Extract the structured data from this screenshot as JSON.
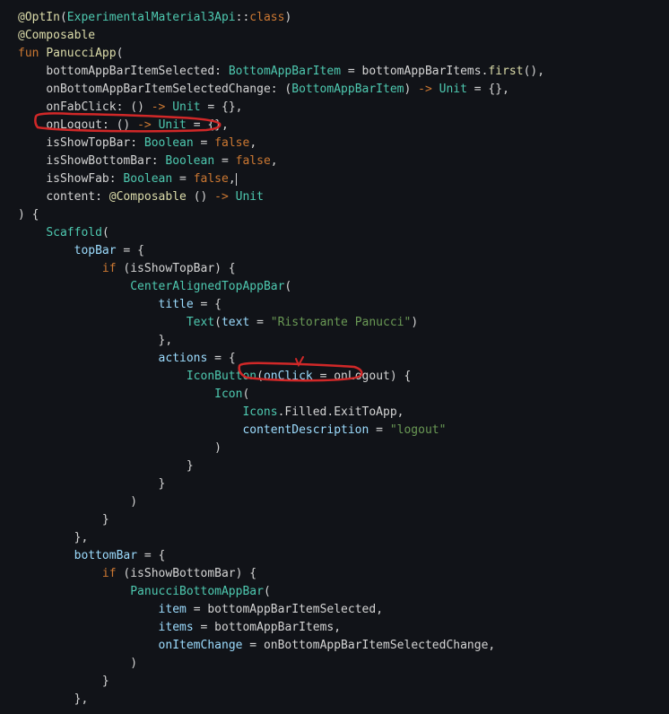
{
  "code": {
    "l1_optin": "@OptIn",
    "l1_exp": "ExperimentalMaterial3Api",
    "l1_class": "class",
    "l2_composable": "@Composable",
    "l3_fun": "fun",
    "l3_name": "PanucciApp",
    "l4_param": "bottomAppBarItemSelected",
    "l4_type": "BottomAppBarItem",
    "l4_val": "bottomAppBarItems",
    "l4_first": "first",
    "l5_param": "onBottomAppBarItemSelectedChange",
    "l5_type1": "BottomAppBarItem",
    "l5_unit": "Unit",
    "l6_param": "onFabClick",
    "l6_unit": "Unit",
    "l7_param": "onLogout",
    "l7_unit": "Unit",
    "l8_param": "isShowTopBar",
    "l8_type": "Boolean",
    "l8_val": "false",
    "l9_param": "isShowBottomBar",
    "l9_type": "Boolean",
    "l9_val": "false",
    "l10_param": "isShowFab",
    "l10_type": "Boolean",
    "l10_val": "false",
    "l11_param": "content",
    "l11_comp": "@Composable",
    "l11_unit": "Unit",
    "scaffold": "Scaffold",
    "topbar": "topBar",
    "if": "if",
    "isShowTopBar": "isShowTopBar",
    "center": "CenterAlignedTopAppBar",
    "title": "title",
    "text_fn": "Text",
    "text_arg": "text",
    "text_val": "\"Ristorante Panucci\"",
    "actions": "actions",
    "iconbutton": "IconButton",
    "onclick": "onClick",
    "onlogout_ref": "onLogout",
    "icon": "Icon",
    "icons": "Icons",
    "filled": "Filled",
    "exit": "ExitToApp",
    "cd": "contentDescription",
    "logout_str": "\"logout\"",
    "bottombar": "bottomBar",
    "isShowBottomBar": "isShowBottomBar",
    "panucci_bottom": "PanucciBottomAppBar",
    "item": "item",
    "item_val": "bottomAppBarItemSelected",
    "items": "items",
    "items_val": "bottomAppBarItems",
    "onitemchange": "onItemChange",
    "onitemchange_val": "onBottomAppBarItemSelectedChange"
  }
}
